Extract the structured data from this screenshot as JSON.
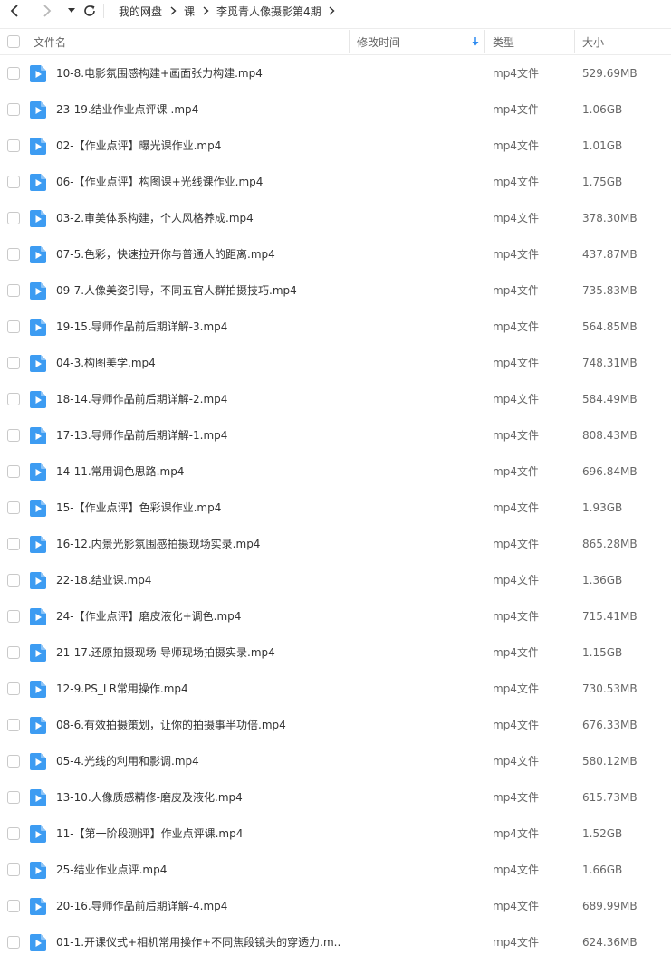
{
  "toolbar": {
    "back_icon": "chevron-left-icon",
    "forward_icon": "chevron-right-icon",
    "dropdown_icon": "caret-down-icon",
    "refresh_icon": "refresh-icon"
  },
  "breadcrumb": [
    "我的网盘",
    "课",
    "李觅青人像摄影第4期"
  ],
  "columns": {
    "name": "文件名",
    "modified": "修改时间",
    "type": "类型",
    "size": "大小",
    "sort_icon": "sort-down-arrow-icon",
    "sort_color": "#2e8bf0"
  },
  "colors": {
    "file_icon": "#3d9cf2",
    "divider": "#ececec"
  },
  "files": [
    {
      "name": "10-8.电影氛围感构建+画面张力构建.mp4",
      "type": "mp4文件",
      "size": "529.69MB"
    },
    {
      "name": "23-19.结业作业点评课   .mp4",
      "type": "mp4文件",
      "size": "1.06GB"
    },
    {
      "name": "02-【作业点评】曝光课作业.mp4",
      "type": "mp4文件",
      "size": "1.01GB"
    },
    {
      "name": "06-【作业点评】构图课+光线课作业.mp4",
      "type": "mp4文件",
      "size": "1.75GB"
    },
    {
      "name": "03-2.审美体系构建，个人风格养成.mp4",
      "type": "mp4文件",
      "size": "378.30MB"
    },
    {
      "name": "07-5.色彩，快速拉开你与普通人的距离.mp4",
      "type": "mp4文件",
      "size": "437.87MB"
    },
    {
      "name": "09-7.人像美姿引导，不同五官人群拍摄技巧.mp4",
      "type": "mp4文件",
      "size": "735.83MB"
    },
    {
      "name": "19-15.导师作品前后期详解-3.mp4",
      "type": "mp4文件",
      "size": "564.85MB"
    },
    {
      "name": "04-3.构图美学.mp4",
      "type": "mp4文件",
      "size": "748.31MB"
    },
    {
      "name": "18-14.导师作品前后期详解-2.mp4",
      "type": "mp4文件",
      "size": "584.49MB"
    },
    {
      "name": "17-13.导师作品前后期详解-1.mp4",
      "type": "mp4文件",
      "size": "808.43MB"
    },
    {
      "name": "14-11.常用调色思路.mp4",
      "type": "mp4文件",
      "size": "696.84MB"
    },
    {
      "name": "15-【作业点评】色彩课作业.mp4",
      "type": "mp4文件",
      "size": "1.93GB"
    },
    {
      "name": "16-12.内景光影氛围感拍摄现场实录.mp4",
      "type": "mp4文件",
      "size": "865.28MB"
    },
    {
      "name": "22-18.结业课.mp4",
      "type": "mp4文件",
      "size": "1.36GB"
    },
    {
      "name": "24-【作业点评】磨皮液化+调色.mp4",
      "type": "mp4文件",
      "size": "715.41MB"
    },
    {
      "name": "21-17.还原拍摄现场-导师现场拍摄实录.mp4",
      "type": "mp4文件",
      "size": "1.15GB"
    },
    {
      "name": "12-9.PS_LR常用操作.mp4",
      "type": "mp4文件",
      "size": "730.53MB"
    },
    {
      "name": "08-6.有效拍摄策划，让你的拍摄事半功倍.mp4",
      "type": "mp4文件",
      "size": "676.33MB"
    },
    {
      "name": "05-4.光线的利用和影调.mp4",
      "type": "mp4文件",
      "size": "580.12MB"
    },
    {
      "name": "13-10.人像质感精修-磨皮及液化.mp4",
      "type": "mp4文件",
      "size": "615.73MB"
    },
    {
      "name": "11-【第一阶段测评】作业点评课.mp4",
      "type": "mp4文件",
      "size": "1.52GB"
    },
    {
      "name": "25-结业作业点评.mp4",
      "type": "mp4文件",
      "size": "1.66GB"
    },
    {
      "name": "20-16.导师作品前后期详解-4.mp4",
      "type": "mp4文件",
      "size": "689.99MB"
    },
    {
      "name": "01-1.开课仪式+相机常用操作+不同焦段镜头的穿透力.m...",
      "type": "mp4文件",
      "size": "624.36MB"
    }
  ]
}
